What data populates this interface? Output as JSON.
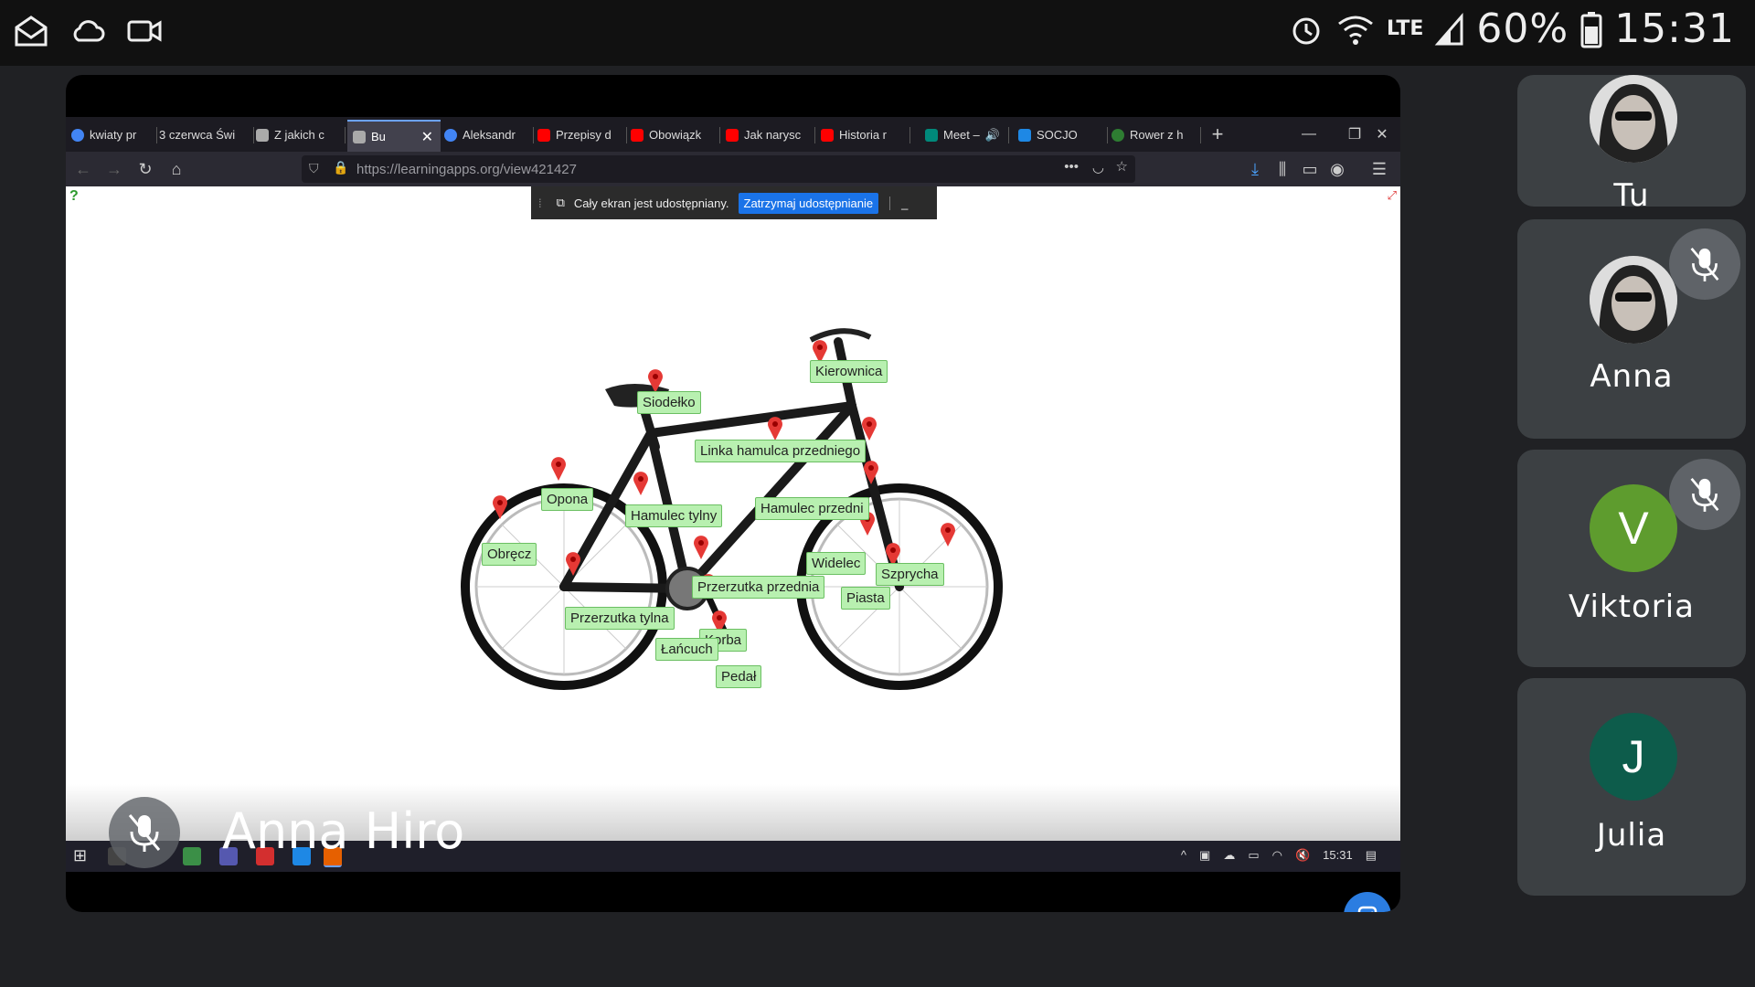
{
  "status_bar": {
    "icons": [
      "mail-icon",
      "cloud-sync-icon",
      "video-icon",
      "alarm-icon",
      "wifi-icon",
      "signal-icon",
      "battery-icon"
    ],
    "network": "LTE",
    "battery": "60%",
    "time": "15:31"
  },
  "browser": {
    "tabs": [
      {
        "label": "kwiaty pr",
        "icon": "google-icon",
        "color": "#4285f4"
      },
      {
        "label": "3 czerwca Świ",
        "icon": "none",
        "color": "#1c1b22"
      },
      {
        "label": "Z jakich c",
        "icon": "doc-icon",
        "color": "#aaaaaa"
      },
      {
        "label": "Bu",
        "icon": "doc-icon",
        "color": "#aaaaaa"
      },
      {
        "label": "Aleksandr",
        "icon": "google-icon",
        "color": "#4285f4"
      },
      {
        "label": "Przepisy d",
        "icon": "youtube-icon",
        "color": "#ff0000"
      },
      {
        "label": "Obowiązk",
        "icon": "youtube-icon",
        "color": "#ff0000"
      },
      {
        "label": "Jak narysc",
        "icon": "youtube-icon",
        "color": "#ff0000"
      },
      {
        "label": "Historia r",
        "icon": "youtube-icon",
        "color": "#ff0000"
      },
      {
        "label": "Meet –",
        "icon": "meet-icon",
        "color": "#00897b"
      },
      {
        "label": "SOCJO",
        "icon": "socjo-icon",
        "color": "#1e88e5"
      },
      {
        "label": "Rower z h",
        "icon": "clover-icon",
        "color": "#2e7d32"
      }
    ],
    "url": "https://learningapps.org/view421427",
    "share_text": "Cały ekran jest udostępniany.",
    "stop_button": "Zatrzymaj udostępnianie",
    "share_min": "_"
  },
  "bike_labels": {
    "kierownica": "Kierownica",
    "siodelko": "Siodełko",
    "linka": "Linka hamulca przedniego",
    "opona": "Opona",
    "hamulec_tylny": "Hamulec tylny",
    "hamulec_przedni": "Hamulec przedni",
    "obrecz": "Obręcz",
    "widelec": "Widelec",
    "szprycha": "Szprycha",
    "przerzutka_przednia": "Przerzutka przednia",
    "piasta": "Piasta",
    "przerzutka_tylna": "Przerzutka tylna",
    "korba": "Korba",
    "lancuch": "Łańcuch",
    "pedal": "Pedał"
  },
  "taskbar": {
    "time": "15:31"
  },
  "presenter": {
    "name": "Anna Hiro"
  },
  "participants": [
    {
      "name": "Tu",
      "avatar": "photo",
      "muted": false
    },
    {
      "name": "Anna",
      "avatar": "photo",
      "muted": true
    },
    {
      "name": "Viktoria",
      "initial": "V",
      "color": "#5e9c2e",
      "muted": true
    },
    {
      "name": "Julia",
      "initial": "J",
      "color": "#0d5c4b",
      "muted": false
    }
  ]
}
